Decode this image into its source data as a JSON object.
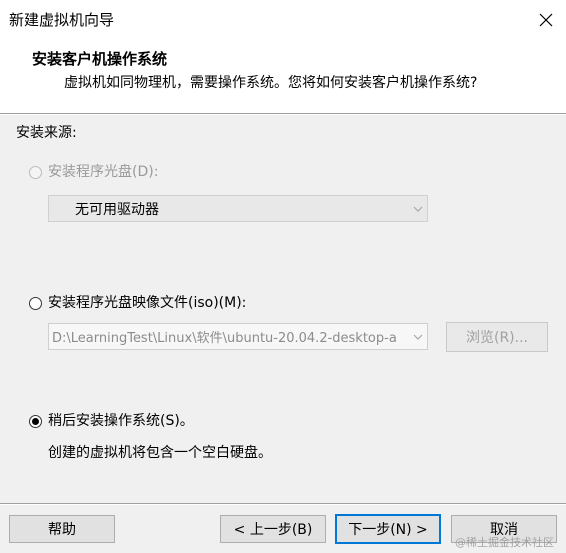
{
  "window": {
    "title": "新建虚拟机向导"
  },
  "header": {
    "title": "安装客户机操作系统",
    "subtitle": "虚拟机如同物理机，需要操作系统。您将如何安装客户机操作系统?"
  },
  "source": {
    "label": "安装来源:",
    "options": {
      "disc": {
        "label": "安装程序光盘(D):",
        "selected": false,
        "enabled": false,
        "drive_value": "无可用驱动器"
      },
      "iso": {
        "label": "安装程序光盘映像文件(iso)(M):",
        "selected": false,
        "enabled": true,
        "path_value": "D:\\LearningTest\\Linux\\软件\\ubuntu-20.04.2-desktop-a",
        "browse_label": "浏览(R)..."
      },
      "later": {
        "label": "稍后安装操作系统(S)。",
        "selected": true,
        "enabled": true,
        "description": "创建的虚拟机将包含一个空白硬盘。"
      }
    }
  },
  "footer": {
    "help_label": "帮助",
    "back_label": "< 上一步(B)",
    "next_label": "下一步(N) >",
    "cancel_label": "取消"
  },
  "watermark": "@稀土掘金技术社区"
}
